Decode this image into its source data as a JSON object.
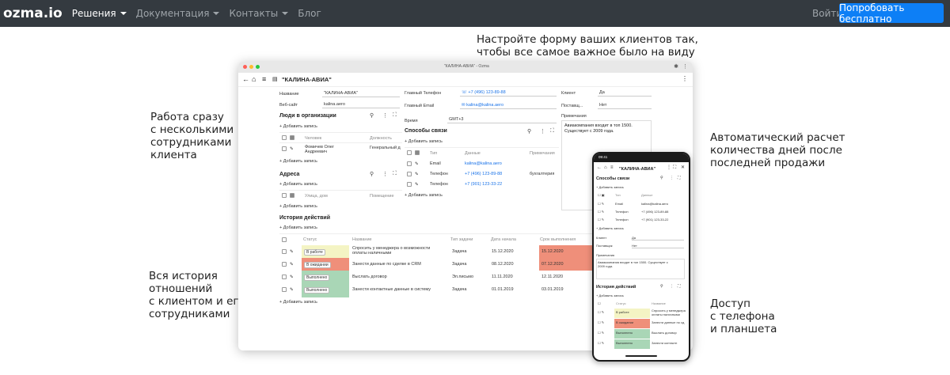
{
  "nav": {
    "brand": "ozma.io",
    "items": [
      "Решения",
      "Документация",
      "Контакты",
      "Блог"
    ],
    "login": "Войти",
    "cta": "Попробовать бесплатно"
  },
  "captions": {
    "top_1": "Настройте форму ваших клиентов так,",
    "top_2": "чтобы все самое важное было на виду",
    "left1": [
      "Работа сразу",
      "с несколькими",
      "сотрудниками",
      "клиента"
    ],
    "left2": [
      "Вся история",
      "отношений",
      "с клиентом и его",
      "сотрудниками"
    ],
    "right1": [
      "Автоматический расчет",
      "количества дней после",
      "последней продажи"
    ],
    "right2": [
      "Доступ",
      "с телефона",
      "и планшета"
    ]
  },
  "window": {
    "title": "\"КАЛИНА-АВИА\" - Ozma",
    "record_title": "\"КАЛИНА-АВИА\"",
    "name_label": "Название",
    "name_value": "\"КАЛИНА-АВИА\"",
    "site_label": "Веб-сайт",
    "site_value": "kalina.aero",
    "phone_label": "Главный Телефон",
    "phone_value": "+7 (496) 123-89-88",
    "email_label": "Главный Email",
    "email_value": "kalina@kalina.aero",
    "time_label": "Время",
    "time_value": "GMT+3",
    "client_label": "Клиент",
    "client_value": "Да",
    "supplier_label": "Поставщ...",
    "supplier_value": "Нет",
    "notes_label": "Примечания",
    "notes_value_1": "Авиакомпания входит в топ 1500.",
    "notes_value_2": "Существует с 2009 года.",
    "add_record": "Добавить запись",
    "people": {
      "title": "Люди в организации",
      "col1": "Человек",
      "col2": "Должность",
      "row_name_1": "Фомичев Олег",
      "row_name_2": "Андреевич",
      "row_pos": "Генеральный д"
    },
    "addresses": {
      "title": "Адреса",
      "col1": "Улица, дом",
      "col2": "Помещение"
    },
    "contacts": {
      "title": "Способы связи",
      "col1": "Тип",
      "col2": "Данные",
      "col3": "Примечания",
      "rows": [
        {
          "type": "Email",
          "data": "kalina@kalina.aero",
          "note": ""
        },
        {
          "type": "Телефон",
          "data": "+7 (496) 123-89-88",
          "note": "бухгалтерия"
        },
        {
          "type": "Телефон",
          "data": "+7 (901) 123-33-22",
          "note": ""
        }
      ]
    },
    "history": {
      "title": "История действий",
      "cols": [
        "Статус",
        "Название",
        "Тип задачи",
        "Дата начала",
        "Срок выполнения"
      ],
      "rows": [
        {
          "status": "В работе",
          "name1": "Спросить у менеджера о возможности",
          "name2": "оплаты наличными",
          "type": "Задача",
          "start": "15.12.2020",
          "due": "15.12.2020"
        },
        {
          "status": "В ожидании",
          "name1": "Занести данные по сделке в CRM",
          "name2": "",
          "type": "Задача",
          "start": "08.12.2020",
          "due": "07.12.2020"
        },
        {
          "status": "Выполнено",
          "name1": "Выслать договор",
          "name2": "",
          "type": "Эл.письмо",
          "start": "11.11.2020",
          "due": "12.11.2020"
        },
        {
          "status": "Выполнено",
          "name1": "Занести контактные данные в систему",
          "name2": "",
          "type": "Задача",
          "start": "01.01.2019",
          "due": "03.01.2019"
        }
      ]
    }
  },
  "phone": {
    "time": "09:41",
    "record_title": "\"КАЛИНА-АВИА\"",
    "contacts_title": "Способы связи",
    "add_record": "Добавить запись",
    "col1": "Тип",
    "col2": "Данные",
    "rows": [
      {
        "type": "Email",
        "data": "kalina@kalina.aero"
      },
      {
        "type": "Телефон",
        "data": "+7 (496) 123-89-88"
      },
      {
        "type": "Телефон",
        "data": "+7 (901) 123-33-22"
      }
    ],
    "client_label": "Клиент",
    "client_value": "Да",
    "supplier_label": "Поставщик",
    "supplier_value": "Нет",
    "notes_label": "Примечания",
    "notes_value_1": "Авиакомпания входит в топ 1500. Существует с",
    "notes_value_2": "2009 года.",
    "history_title": "История действий",
    "h_col1": "Статус",
    "h_col2": "Название",
    "h_rows": [
      {
        "status": "В работе",
        "name1": "Спросить у менеджера",
        "name2": "оплаты наличными"
      },
      {
        "status": "В ожидании",
        "name1": "Занести данные по сд",
        "name2": ""
      },
      {
        "status": "Выполнено",
        "name1": "Выслать договор",
        "name2": ""
      },
      {
        "status": "Выполнено",
        "name1": "Занести контактн",
        "name2": ""
      }
    ]
  },
  "colors": {
    "nav_bg": "#343a40",
    "cta": "#0d7ff6",
    "status_work": "#f4f4c4",
    "status_wait": "#ef8f7a",
    "status_done": "#a9d6b6",
    "overdue": "#ef8f7a"
  }
}
